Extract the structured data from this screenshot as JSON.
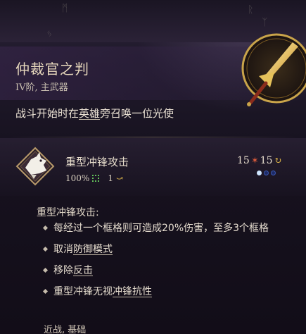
{
  "item": {
    "name": "仲裁官之判",
    "subtitle": "IV阶, 主武器",
    "description_pre": "战斗开始时在",
    "description_link": "英雄",
    "description_post": "旁召唤一位光使"
  },
  "ability": {
    "name": "重型冲锋攻击",
    "hit_chance": "100%",
    "range": "1",
    "cost_left": "15",
    "cost_right": "15",
    "icon": "white-wolf-charge-icon",
    "dot_colors": [
      "#cfe6ff",
      "#2a3f8f",
      "#2a3f8f"
    ]
  },
  "details": {
    "heading": "重型冲锋攻击:",
    "bullet1": "每经过一个框格则可造成20%伤害，至多3个框格",
    "bullet2_pre": "取消",
    "bullet2_link": "防御模式",
    "bullet3_pre": "移除",
    "bullet3_link": "反击",
    "bullet4_pre": "重型冲锋无视",
    "bullet4_link": "冲锋抗性"
  },
  "tags": "近战, 基础",
  "colors": {
    "accent_gold": "#d9b24a",
    "cost_red": "#d85a3a",
    "range_green": "#63c05a"
  }
}
